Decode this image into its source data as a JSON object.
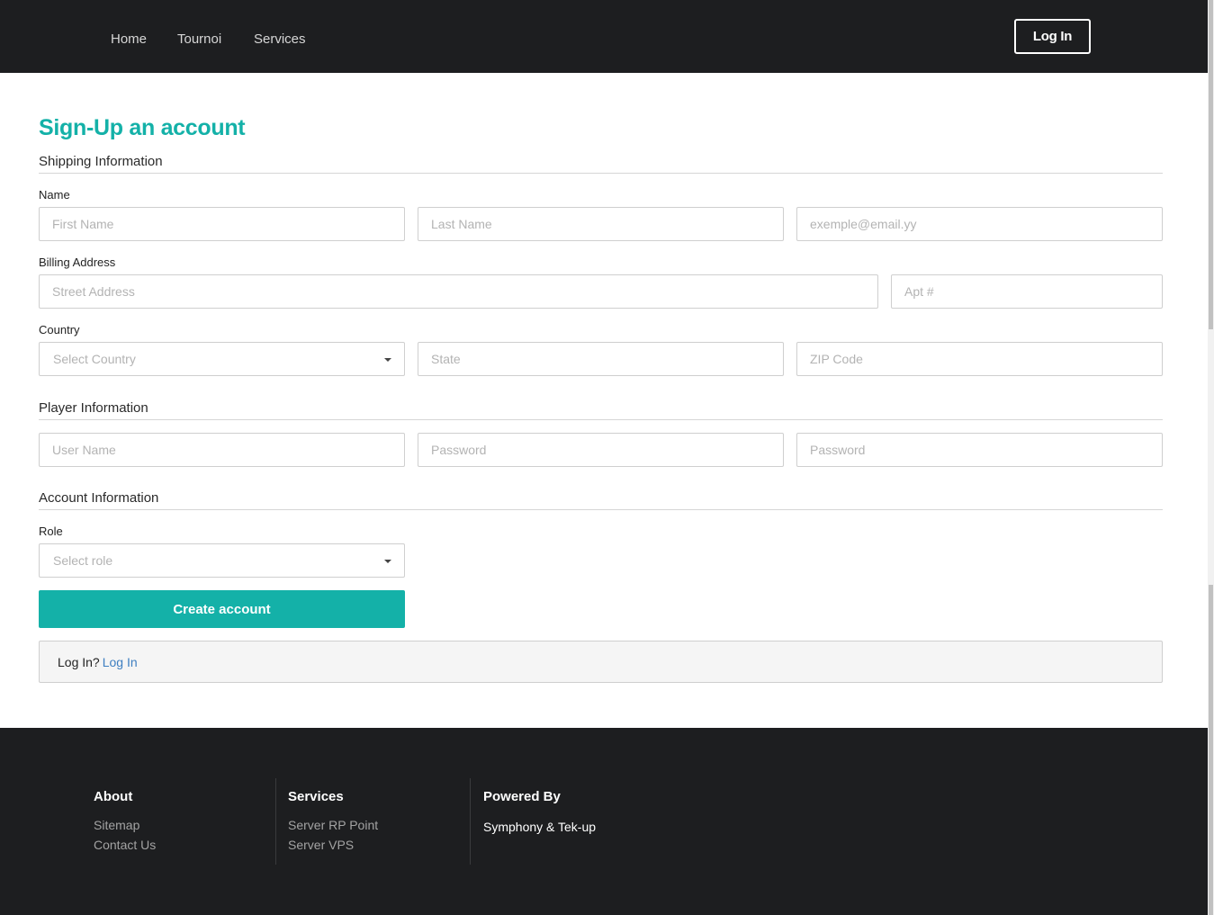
{
  "nav": {
    "links": [
      "Home",
      "Tournoi",
      "Services"
    ],
    "login_label": "Log In"
  },
  "form": {
    "title": "Sign-Up an account",
    "shipping": {
      "title": "Shipping Information",
      "name_label": "Name",
      "first_name_placeholder": "First Name",
      "last_name_placeholder": "Last Name",
      "email_placeholder": "exemple@email.yy",
      "billing_label": "Billing Address",
      "street_placeholder": "Street Address",
      "apt_placeholder": "Apt #",
      "country_label": "Country",
      "country_select": "Select Country",
      "state_placeholder": "State",
      "zip_placeholder": "ZIP Code"
    },
    "player": {
      "title": "Player Information",
      "username_placeholder": "User Name",
      "password_placeholder": "Password",
      "password_confirm_placeholder": "Password"
    },
    "account": {
      "title": "Account Information",
      "role_label": "Role",
      "role_select": "Select role"
    },
    "create_button": "Create account",
    "login_prompt": "Log In?",
    "login_link": "Log In"
  },
  "footer": {
    "about": {
      "title": "About",
      "links": [
        "Sitemap",
        "Contact Us"
      ]
    },
    "services": {
      "title": "Services",
      "links": [
        "Server RP Point",
        "Server VPS"
      ]
    },
    "powered": {
      "title": "Powered By",
      "text": "Symphony & Tek-up"
    }
  },
  "colors": {
    "accent": "#14b1a8",
    "dark_bg": "#1d1e20",
    "link": "#3e7fc1"
  }
}
